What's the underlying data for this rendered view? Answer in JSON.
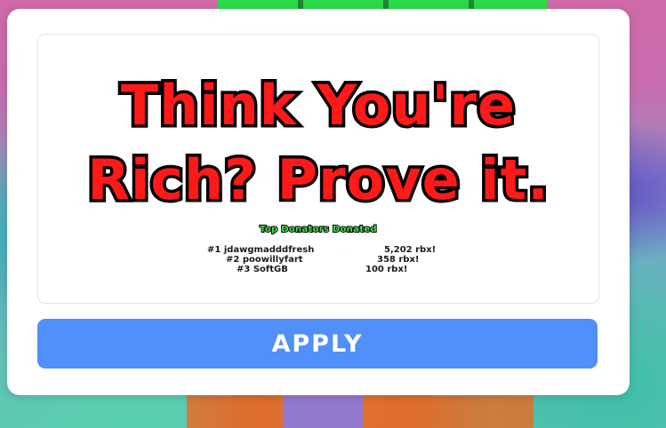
{
  "preview": {
    "headline_line1": "Think You're",
    "headline_line2": "Rich?  Prove it.",
    "donors_title": "Top Donators Donated",
    "donors": [
      {
        "name": "#1 jdawgmadddfresh",
        "amount": "5,202 rbx!"
      },
      {
        "name": "#2 poowillyfart",
        "amount": "358 rbx!"
      },
      {
        "name": "#3 SoftGB",
        "amount": "100 rbx!"
      }
    ]
  },
  "apply_label": "APPLY",
  "colors": {
    "headline": "#ff1a1a",
    "donors_title": "#45e84a",
    "button": "#5090f8",
    "modal": "#ffffff"
  }
}
